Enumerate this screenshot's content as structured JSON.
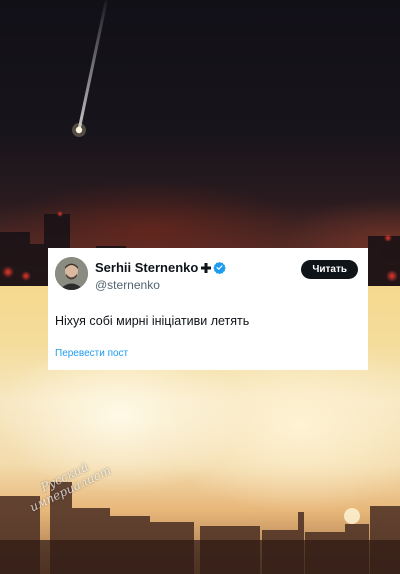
{
  "photos": {
    "top_icon": "night-sky-missile-photo",
    "bottom_icon": "city-explosion-photo"
  },
  "watermark": {
    "line1": "Русский",
    "line2": "империалист"
  },
  "tweet": {
    "author_name": "Serhii Sternenko",
    "author_handle": "@sternenko",
    "follow_label": "Читать",
    "text": "Ніхуя собі мирні ініціативи летять",
    "translate_label": "Перевести пост",
    "icons": {
      "avatar": "avatar",
      "cross": "cross-icon",
      "verified": "verified-icon"
    }
  },
  "colors": {
    "card_bg": "#ffffff",
    "text_primary": "#0f1419",
    "text_secondary": "#536471",
    "link": "#1d9bf0",
    "follow_bg": "#0f1419",
    "verified": "#1d9bf0"
  }
}
